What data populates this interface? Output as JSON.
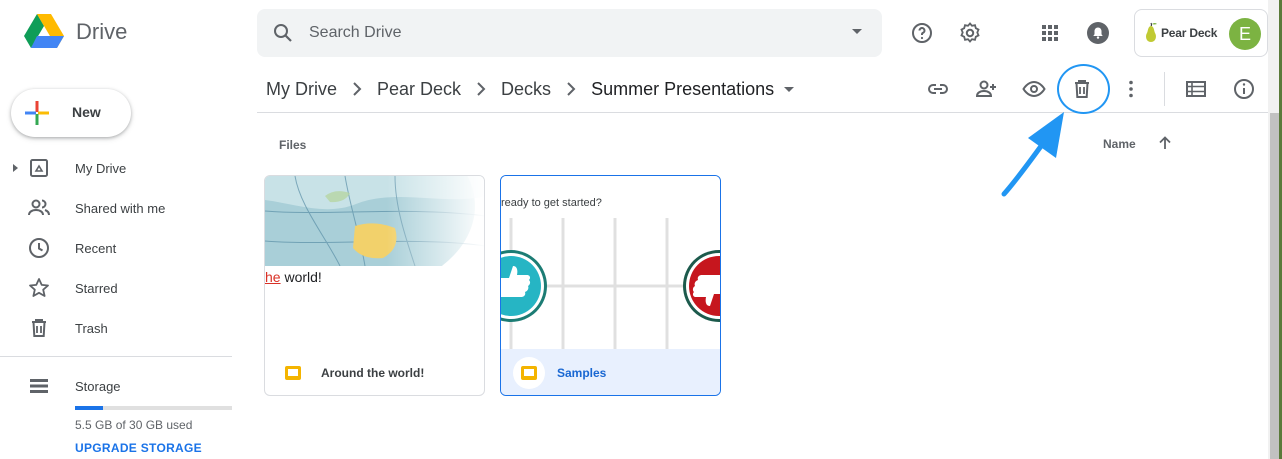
{
  "app": {
    "name": "Drive"
  },
  "search": {
    "placeholder": "Search Drive"
  },
  "account": {
    "org_name": "Pear Deck",
    "avatar_letter": "E"
  },
  "sidebar": {
    "new_label": "New",
    "items": [
      {
        "label": "My Drive"
      },
      {
        "label": "Shared with me"
      },
      {
        "label": "Recent"
      },
      {
        "label": "Starred"
      },
      {
        "label": "Trash"
      }
    ],
    "storage": {
      "label": "Storage",
      "used_text": "5.5 GB of 30 GB used",
      "used_fraction": 0.18,
      "upgrade_label": "UPGRADE STORAGE"
    }
  },
  "breadcrumb": [
    "My Drive",
    "Pear Deck",
    "Decks",
    "Summer Presentations"
  ],
  "files": {
    "section_label": "Files",
    "sort_label": "Name",
    "items": [
      {
        "name": "Around the world!",
        "thumb_text_red": "he",
        "thumb_text": " world!"
      },
      {
        "name": "Samples",
        "thumb_text": "ready to get started?"
      }
    ]
  },
  "colors": {
    "accent": "#1a73e8",
    "highlight": "#2196f3",
    "selected_bg": "#e8f0fe",
    "slides_yellow": "#f4b400"
  }
}
